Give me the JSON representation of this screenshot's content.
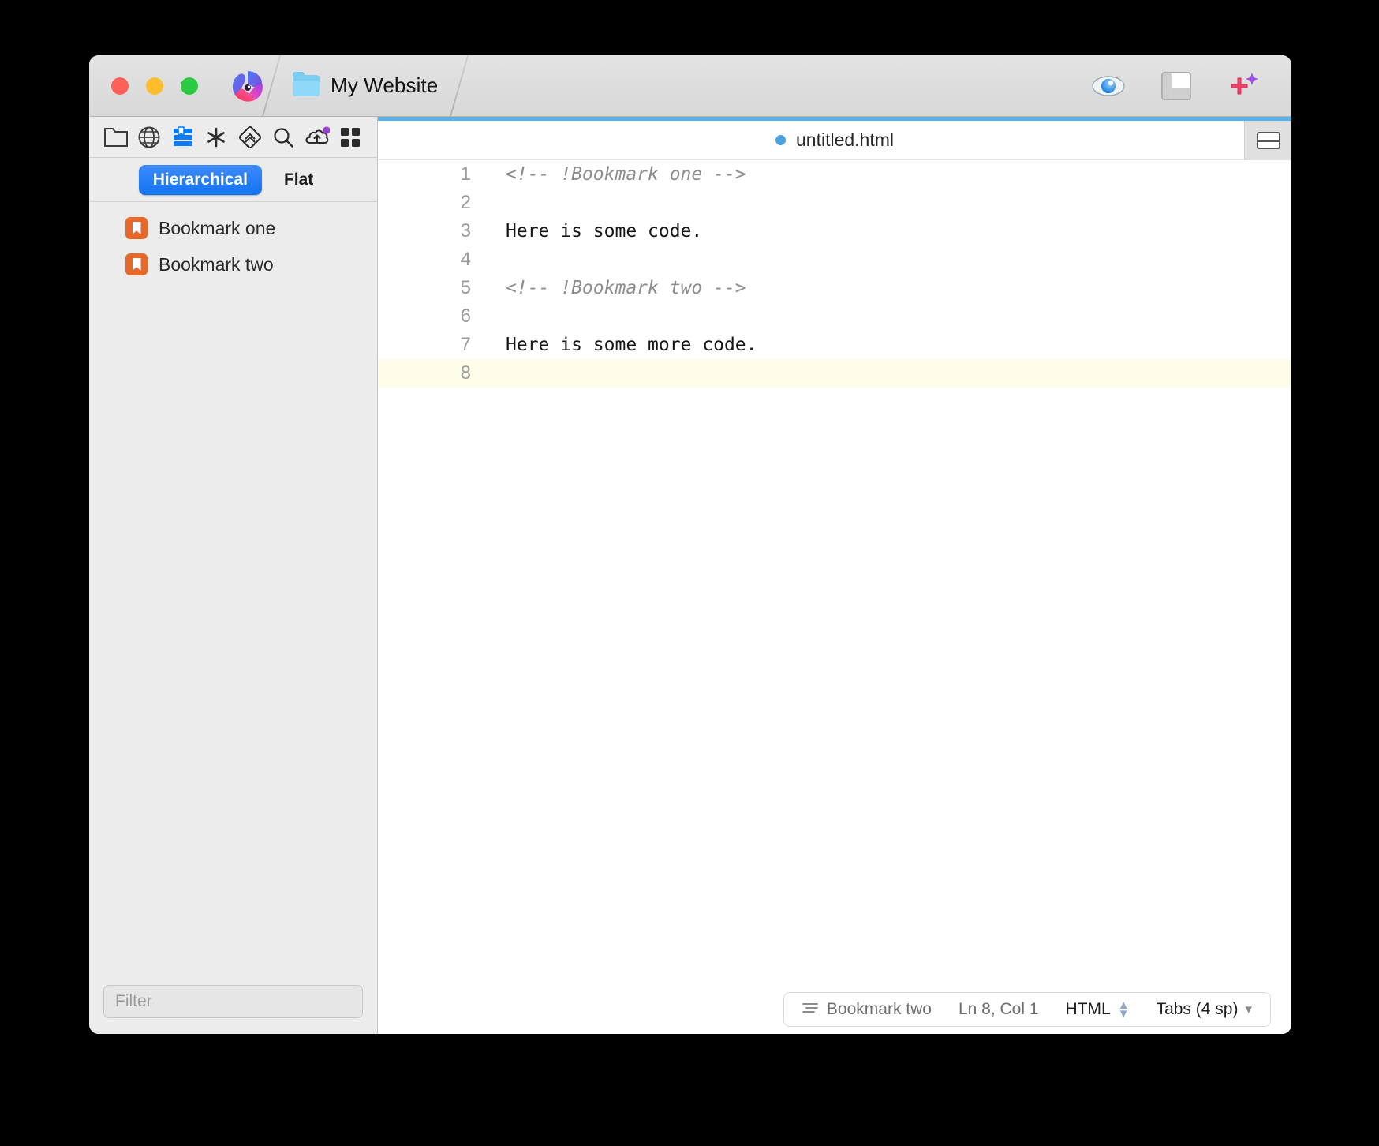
{
  "window": {
    "traffic_lights": [
      "close",
      "minimize",
      "zoom"
    ],
    "app_icon": "nova-app-icon",
    "project_tab": {
      "label": "My Website",
      "icon": "folder-icon"
    },
    "toolbar_right": [
      {
        "name": "preview-eye-button",
        "icon": "eye-icon"
      },
      {
        "name": "layout-toggle-button",
        "icon": "split-layout-icon"
      },
      {
        "name": "new-ai-button",
        "icon": "sparkle-plus-icon"
      }
    ]
  },
  "sidebar": {
    "toolbar_icons": [
      {
        "name": "files-tab",
        "icon": "folder-open-icon",
        "active": false
      },
      {
        "name": "globe-tab",
        "icon": "globe-icon",
        "active": false
      },
      {
        "name": "bookmarks-tab",
        "icon": "bookmarks-stack-icon",
        "active": true
      },
      {
        "name": "snippets-tab",
        "icon": "asterisk-icon",
        "active": false
      },
      {
        "name": "source-control-tab",
        "icon": "git-diamond-icon",
        "active": false
      },
      {
        "name": "search-tab",
        "icon": "magnifier-icon",
        "active": false
      },
      {
        "name": "publish-tab",
        "icon": "cloud-upload-icon",
        "active": false,
        "badge": true
      },
      {
        "name": "extensions-tab",
        "icon": "grid-squares-icon",
        "active": false
      }
    ],
    "segments": [
      {
        "label": "Hierarchical",
        "active": true
      },
      {
        "label": "Flat",
        "active": false
      }
    ],
    "bookmarks": [
      {
        "label": "Bookmark one",
        "icon": "bookmark-ribbon-icon"
      },
      {
        "label": "Bookmark two",
        "icon": "bookmark-ribbon-icon"
      }
    ],
    "filter": {
      "placeholder": "Filter",
      "value": ""
    }
  },
  "editor": {
    "accent_color": "#56b2e8",
    "tab": {
      "filename": "untitled.html",
      "unsaved": true
    },
    "split_toggle_icon": "split-horizontal-icon",
    "lines": [
      {
        "num": "1",
        "text": "<!-- !Bookmark one -->",
        "comment": true,
        "current": false
      },
      {
        "num": "2",
        "text": "",
        "comment": false,
        "current": false
      },
      {
        "num": "3",
        "text": "Here is some code.",
        "comment": false,
        "current": false
      },
      {
        "num": "4",
        "text": "",
        "comment": false,
        "current": false
      },
      {
        "num": "5",
        "text": "<!-- !Bookmark two -->",
        "comment": true,
        "current": false
      },
      {
        "num": "6",
        "text": "",
        "comment": false,
        "current": false
      },
      {
        "num": "7",
        "text": "Here is some more code.",
        "comment": false,
        "current": false
      },
      {
        "num": "8",
        "text": "",
        "comment": false,
        "current": true
      }
    ]
  },
  "status_bar": {
    "breadcrumb": {
      "icon": "lines-list-icon",
      "label": "Bookmark two"
    },
    "cursor": "Ln 8, Col 1",
    "language": "HTML",
    "indentation": "Tabs (4 sp)"
  }
}
